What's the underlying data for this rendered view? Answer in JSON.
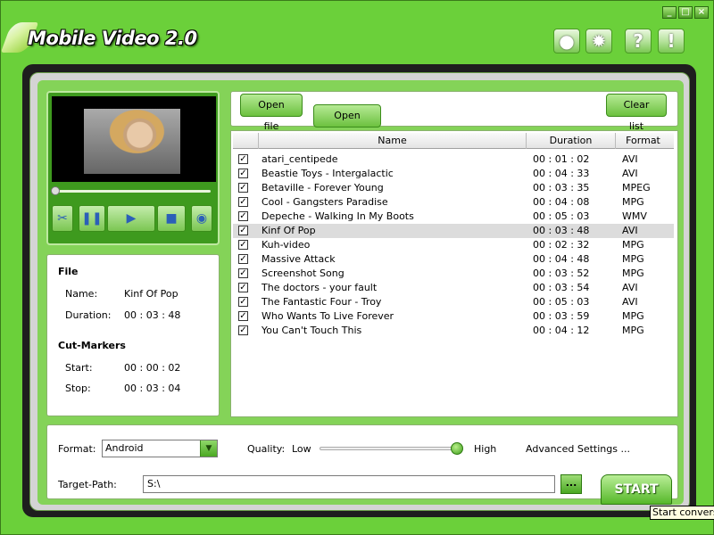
{
  "app": {
    "title": "Mobile Video 2.0"
  },
  "window_controls": {
    "minimize": "_",
    "maximize": "□",
    "close": "×"
  },
  "toolbar": [
    {
      "name": "globe-button",
      "icon": "globe-icon",
      "glyph": "●"
    },
    {
      "name": "settings-button",
      "icon": "gear-icon",
      "glyph": "✹"
    },
    {
      "name": "help-button",
      "icon": "question-icon",
      "glyph": "?"
    },
    {
      "name": "info-button",
      "icon": "exclamation-icon",
      "glyph": "!"
    }
  ],
  "player": {
    "buttons": [
      {
        "name": "cut-button",
        "icon": "scissors-icon",
        "glyph": "✂"
      },
      {
        "name": "pause-button",
        "icon": "pause-icon",
        "glyph": "❚❚"
      },
      {
        "name": "play-button",
        "icon": "play-icon",
        "glyph": "▶"
      },
      {
        "name": "stop-button",
        "icon": "stop-icon",
        "glyph": "■"
      },
      {
        "name": "snapshot-button",
        "icon": "camera-icon",
        "glyph": "◉"
      }
    ]
  },
  "file_info": {
    "heading": "File",
    "name_label": "Name:",
    "name_value": "Kinf Of Pop",
    "duration_label": "Duration:",
    "duration_value": "00 : 03 : 48",
    "markers_heading": "Cut-Markers",
    "start_label": "Start:",
    "start_value": "00 : 00 : 02",
    "stop_label": "Stop:",
    "stop_value": "00 : 03 : 04"
  },
  "tabs": {
    "open_file": "Open file",
    "open_dvd": "Open DVD",
    "clear_list": "Clear list"
  },
  "list": {
    "columns": [
      "Name",
      "Duration",
      "Format"
    ],
    "rows": [
      {
        "checked": true,
        "name": "atari_centipede",
        "duration": "00 : 01 : 02",
        "format": "AVI"
      },
      {
        "checked": true,
        "name": "Beastie Toys - Intergalactic",
        "duration": "00 : 04 : 33",
        "format": "AVI"
      },
      {
        "checked": true,
        "name": "Betaville - Forever Young",
        "duration": "00 : 03 : 35",
        "format": "MPEG"
      },
      {
        "checked": true,
        "name": "Cool - Gangsters Paradise",
        "duration": "00 : 04 : 08",
        "format": "MPG"
      },
      {
        "checked": true,
        "name": "Depeche - Walking In My Boots",
        "duration": "00 : 05 : 03",
        "format": "WMV"
      },
      {
        "checked": true,
        "name": "Kinf Of Pop",
        "duration": "00 : 03 : 48",
        "format": "AVI",
        "selected": true
      },
      {
        "checked": true,
        "name": "Kuh-video",
        "duration": "00 : 02 : 32",
        "format": "MPG"
      },
      {
        "checked": true,
        "name": "Massive Attack",
        "duration": "00 : 04 : 48",
        "format": "MPG"
      },
      {
        "checked": true,
        "name": "Screenshot Song",
        "duration": "00 : 03 : 52",
        "format": "MPG"
      },
      {
        "checked": true,
        "name": "The doctors - your fault",
        "duration": "00 : 03 : 54",
        "format": "AVI"
      },
      {
        "checked": true,
        "name": "The Fantastic Four - Troy",
        "duration": "00 : 05 : 03",
        "format": "AVI"
      },
      {
        "checked": true,
        "name": "Who Wants To Live Forever",
        "duration": "00 : 03 : 59",
        "format": "MPG"
      },
      {
        "checked": true,
        "name": "You Can't Touch This",
        "duration": "00 : 04 : 12",
        "format": "MPG"
      }
    ]
  },
  "settings": {
    "format_label": "Format:",
    "format_value": "Android",
    "quality_label": "Quality:",
    "quality_low": "Low",
    "quality_high": "High",
    "quality_level": 1.0,
    "advanced": "Advanced Settings ...",
    "target_label": "Target-Path:",
    "target_value": "S:\\",
    "browse": "...",
    "start": "START"
  },
  "tooltip": "Start conversion",
  "colors": {
    "accent": "#6bd03a",
    "rim": "#1e1e1e",
    "panel": "#84d358"
  }
}
